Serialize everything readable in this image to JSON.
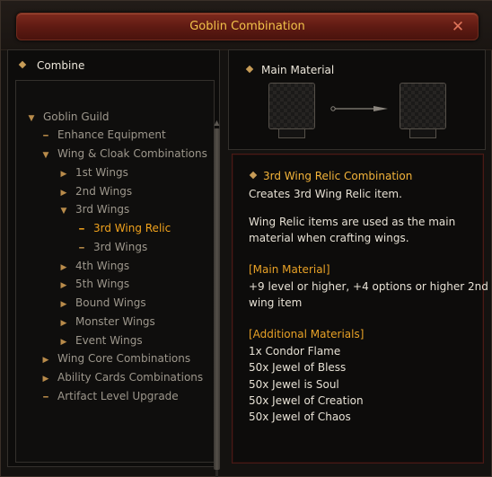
{
  "window": {
    "title": "Goblin Combination"
  },
  "left": {
    "header": "Combine",
    "tree": [
      {
        "label": "Goblin Guild",
        "icon": "arrow-down"
      },
      {
        "label": "Enhance Equipment",
        "icon": "dash"
      },
      {
        "label": "Wing & Cloak Combinations",
        "icon": "arrow-down"
      },
      {
        "label": "1st Wings",
        "icon": "arrow-right"
      },
      {
        "label": "2nd Wings",
        "icon": "arrow-right"
      },
      {
        "label": "3rd Wings",
        "icon": "arrow-down"
      },
      {
        "label": "3rd Wing Relic",
        "icon": "dash",
        "selected": true
      },
      {
        "label": "3rd Wings",
        "icon": "dash"
      },
      {
        "label": "4th Wings",
        "icon": "arrow-right"
      },
      {
        "label": "5th Wings",
        "icon": "arrow-right"
      },
      {
        "label": "Bound Wings",
        "icon": "arrow-right"
      },
      {
        "label": "Monster Wings",
        "icon": "arrow-right"
      },
      {
        "label": "Event Wings",
        "icon": "arrow-right"
      },
      {
        "label": "Wing Core Combinations",
        "icon": "arrow-right"
      },
      {
        "label": "Ability Cards Combinations",
        "icon": "arrow-right"
      },
      {
        "label": "Artifact Level Upgrade",
        "icon": "dash"
      }
    ]
  },
  "main_material": {
    "label": "Main Material"
  },
  "info": {
    "title": "3rd Wing Relic Combination",
    "lines": [
      {
        "text": "Creates 3rd Wing Relic item."
      },
      {
        "text": "Wing Relic items are used as the main"
      },
      {
        "text": "material when crafting wings."
      },
      {
        "text": "[Main Material]",
        "heading": true
      },
      {
        "text": "+9 level or higher, +4 options or higher 2nd"
      },
      {
        "text": "wing item"
      },
      {
        "text": "[Additional Materials]",
        "heading": true
      },
      {
        "text": "1x Condor Flame"
      },
      {
        "text": "50x Jewel of Bless"
      },
      {
        "text": "50x Jewel is Soul"
      },
      {
        "text": "50x Jewel of Creation"
      },
      {
        "text": "50x Jewel of Chaos"
      }
    ]
  },
  "colors": {
    "title": "#f3c24a",
    "selected": "#f0a21d",
    "heading": "#e8a126",
    "titlebar": "#7d2a1d"
  }
}
